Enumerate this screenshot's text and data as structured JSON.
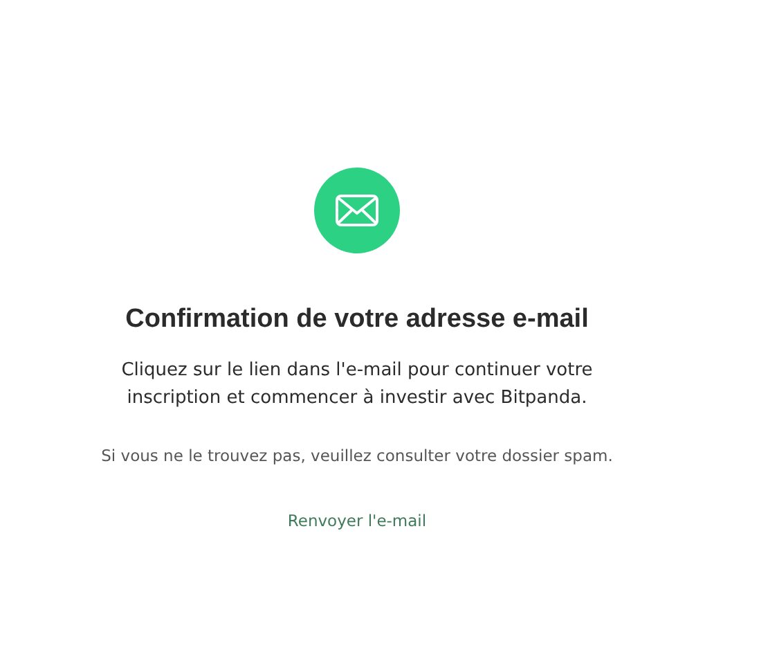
{
  "title": "Confirmation de votre adresse e-mail",
  "message": "Cliquez sur le lien dans l'e-mail pour continuer votre inscription et commencer à investir avec Bitpanda.",
  "hint": "Si vous ne le trouvez pas, veuillez consulter votre dossier spam.",
  "resend_link": "Renvoyer l'e-mail"
}
